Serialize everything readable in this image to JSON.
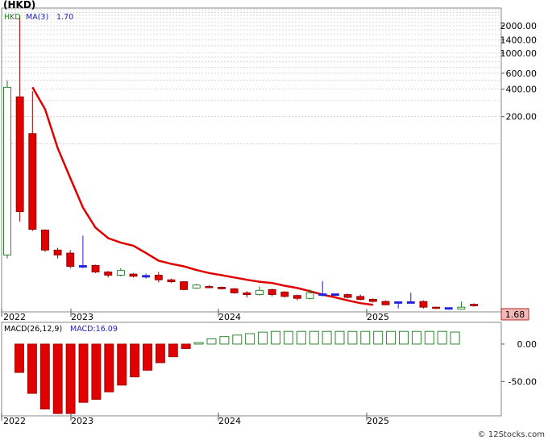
{
  "title": "(HKD)",
  "footer": "© 12Stocks.com",
  "colors": {
    "up": "#1a7a1a",
    "down": "#e00000",
    "ma_line": "#e00000",
    "flat": "#2020dd",
    "macd_up": "#1a7a1a",
    "macd_down": "#e00000",
    "text_blue": "#2020c0",
    "text_green": "#208020",
    "last_price_bg": "#f4b8b8"
  },
  "chart_data": [
    {
      "type": "candlestick",
      "legend": {
        "symbol": "HKD",
        "indicator": "MA(3)",
        "indicator_value": "1.70"
      },
      "last_price_label": "1.68",
      "y_scale": "log",
      "y_ticks": [
        {
          "value": 2000,
          "label": "2000.00"
        },
        {
          "value": 1400,
          "label": "1400.00"
        },
        {
          "value": 1000,
          "label": "1000.00"
        },
        {
          "value": 600,
          "label": "600.00"
        },
        {
          "value": 400,
          "label": "400.00"
        },
        {
          "value": 200,
          "label": "200.00"
        }
      ],
      "x_labels": [
        "2022",
        "2023",
        "2024",
        "2025"
      ],
      "ma_values": [
        420,
        240,
        90,
        42,
        20,
        12,
        9.2,
        8.2,
        7.6,
        6.3,
        5.2,
        4.8,
        4.5,
        4.1,
        3.8,
        3.6,
        3.4,
        3.2,
        3.05,
        2.95,
        2.75,
        2.6,
        2.4,
        2.2,
        2.05,
        1.9,
        1.77,
        1.7
      ],
      "candles": [
        {
          "open": 6,
          "close": 420,
          "high": 500,
          "low": 5.5
        },
        {
          "open": 330,
          "close": 18,
          "high": 2600,
          "low": 14
        },
        {
          "open": 130,
          "close": 11.5,
          "high": 380,
          "low": 11
        },
        {
          "open": 11.3,
          "close": 6.8,
          "high": 11.5,
          "low": 6.5
        },
        {
          "open": 6.8,
          "close": 6.0,
          "high": 7.2,
          "low": 5.5
        },
        {
          "open": 6.3,
          "close": 4.5,
          "high": 6.8,
          "low": 4.3
        },
        {
          "open": 4.5,
          "close": 4.5,
          "high": 9.8,
          "low": 4.3
        },
        {
          "open": 4.6,
          "close": 3.9,
          "high": 4.7,
          "low": 3.8
        },
        {
          "open": 3.9,
          "close": 3.6,
          "high": 4.0,
          "low": 3.4
        },
        {
          "open": 3.6,
          "close": 4.05,
          "high": 4.3,
          "low": 3.5
        },
        {
          "open": 3.7,
          "close": 3.5,
          "high": 3.8,
          "low": 3.4
        },
        {
          "open": 3.5,
          "close": 3.45,
          "high": 3.75,
          "low": 3.3
        },
        {
          "open": 3.6,
          "close": 3.2,
          "high": 3.9,
          "low": 3.0
        },
        {
          "open": 3.2,
          "close": 3.05,
          "high": 3.3,
          "low": 2.95
        },
        {
          "open": 3.05,
          "close": 2.5,
          "high": 3.1,
          "low": 2.45
        },
        {
          "open": 2.6,
          "close": 2.8,
          "high": 2.9,
          "low": 2.55
        },
        {
          "open": 2.7,
          "close": 2.65,
          "high": 2.8,
          "low": 2.6
        },
        {
          "open": 2.65,
          "close": 2.55,
          "high": 2.7,
          "low": 2.5
        },
        {
          "open": 2.55,
          "close": 2.3,
          "high": 2.6,
          "low": 2.25
        },
        {
          "open": 2.3,
          "close": 2.2,
          "high": 2.4,
          "low": 2.05
        },
        {
          "open": 2.2,
          "close": 2.45,
          "high": 2.7,
          "low": 2.15
        },
        {
          "open": 2.5,
          "close": 2.2,
          "high": 2.55,
          "low": 2.1
        },
        {
          "open": 2.35,
          "close": 2.1,
          "high": 2.4,
          "low": 2.05
        },
        {
          "open": 2.15,
          "close": 2.0,
          "high": 2.2,
          "low": 1.9
        },
        {
          "open": 2.0,
          "close": 2.3,
          "high": 2.5,
          "low": 1.95
        },
        {
          "open": 2.2,
          "close": 2.2,
          "high": 3.1,
          "low": 2.1
        },
        {
          "open": 2.2,
          "close": 2.2,
          "high": 2.25,
          "low": 2.15
        },
        {
          "open": 2.2,
          "close": 2.05,
          "high": 2.25,
          "low": 2.0
        },
        {
          "open": 2.1,
          "close": 1.95,
          "high": 2.2,
          "low": 1.9
        },
        {
          "open": 1.95,
          "close": 1.85,
          "high": 2.0,
          "low": 1.8
        },
        {
          "open": 1.85,
          "close": 1.7,
          "high": 1.9,
          "low": 1.68
        },
        {
          "open": 1.8,
          "close": 1.8,
          "high": 1.85,
          "low": 1.55
        },
        {
          "open": 1.8,
          "close": 1.8,
          "high": 2.3,
          "low": 1.78
        },
        {
          "open": 1.85,
          "close": 1.6,
          "high": 1.9,
          "low": 1.55
        },
        {
          "open": 1.6,
          "close": 1.55,
          "high": 1.62,
          "low": 1.52
        },
        {
          "open": 1.55,
          "close": 1.55,
          "high": 1.58,
          "low": 1.5
        },
        {
          "open": 1.52,
          "close": 1.6,
          "high": 1.85,
          "low": 1.5
        },
        {
          "open": 1.72,
          "close": 1.66,
          "high": 1.76,
          "low": 1.62
        }
      ]
    },
    {
      "type": "bar",
      "legend": {
        "indicator": "MACD(26,12,9)",
        "value_label": "MACD:16.09"
      },
      "y_ticks": [
        {
          "value": 0,
          "label": "0.00"
        },
        {
          "value": -50,
          "label": "-50.00"
        }
      ],
      "x_labels": [
        "2022",
        "2023",
        "2024",
        "2025"
      ],
      "values": [
        -38,
        -66,
        -87,
        -93,
        -93,
        -78,
        -74,
        -64,
        -55,
        -44,
        -35,
        -25,
        -17,
        -6,
        2,
        7,
        10,
        12,
        14,
        16,
        17,
        17,
        17,
        17,
        17,
        17,
        17,
        17,
        17,
        17,
        17,
        17,
        17,
        17,
        16.09
      ]
    }
  ]
}
